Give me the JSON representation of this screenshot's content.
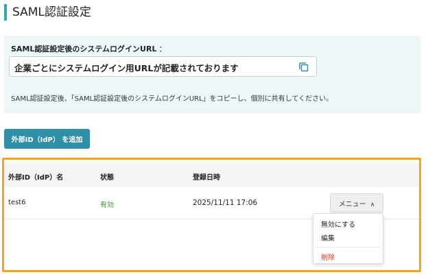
{
  "page": {
    "title": "SAML認証設定"
  },
  "url_section": {
    "label": "SAML認証設定後のシステムログインURL",
    "colon": "：",
    "field_value": "企業ごとにシステムログイン用URLが記載されております",
    "copy_icon": "copy-icon",
    "help_text": "SAML認証設定後、「SAML認証設定後のシステムログインURL」をコピーし、個別に共有してください。"
  },
  "actions": {
    "add_label": "外部ID（IdP） を追加"
  },
  "table": {
    "headers": [
      "外部ID（IdP）名",
      "状態",
      "登録日時"
    ],
    "rows": [
      {
        "name": "test6",
        "status": "有効",
        "date": "2025/11/11 17:06",
        "menu_label": "メニュー"
      }
    ]
  },
  "menu": {
    "items": [
      {
        "label": "無効にする"
      },
      {
        "label": "編集"
      },
      {
        "label": "削除"
      }
    ]
  },
  "colors": {
    "accent": "#2fa3c0",
    "button": "#2f8fa6",
    "highlight": "#f5a21c",
    "status_ok": "#3a8f2e",
    "danger": "#d83a2f"
  }
}
